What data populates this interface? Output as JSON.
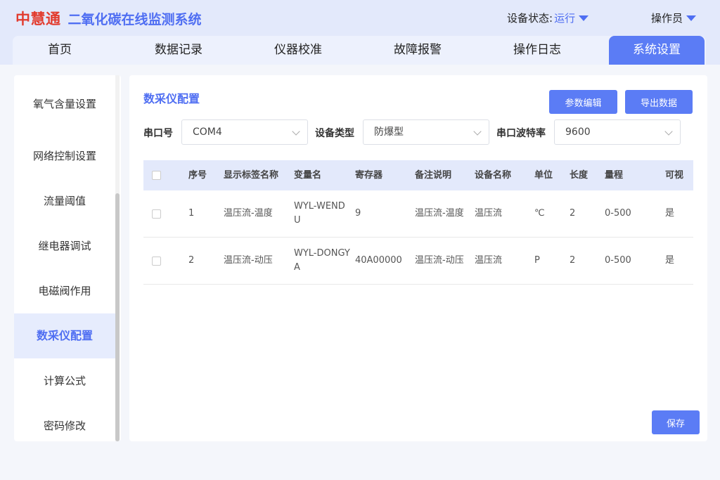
{
  "header": {
    "logo": "中慧通",
    "title": "二氧化碳在线监测系统",
    "status_label": "设备状态:",
    "status_value": "运行",
    "operator": "操作员",
    "accent": "#4f6ef2",
    "brand_red": "#e23b2e"
  },
  "nav": {
    "tabs": [
      {
        "label": "首页"
      },
      {
        "label": "数据记录"
      },
      {
        "label": "仪器校准"
      },
      {
        "label": "故障报警"
      },
      {
        "label": "操作日志"
      },
      {
        "label": "系统设置",
        "active": true
      }
    ]
  },
  "sidebar": {
    "items": [
      {
        "label": "氧气含量设置"
      },
      {
        "label": "网络控制设置"
      },
      {
        "label": "流量阈值"
      },
      {
        "label": "继电器调试"
      },
      {
        "label": "电磁阀作用"
      },
      {
        "label": "数采仪配置",
        "active": true
      },
      {
        "label": "计算公式"
      },
      {
        "label": "密码修改"
      }
    ]
  },
  "main": {
    "title": "数采仪配置",
    "edit_button": "参数编辑",
    "export_button": "导出数据",
    "save_button": "保存",
    "serial_label": "串口号",
    "serial_value": "COM4",
    "device_type_label": "设备类型",
    "device_type_value": "防爆型",
    "baud_label": "串口波特率",
    "baud_value": "9600"
  },
  "table": {
    "columns": [
      "序号",
      "显示标签名称",
      "变量名",
      "寄存器",
      "备注说明",
      "设备名称",
      "单位",
      "长度",
      "量程",
      "可视"
    ],
    "rows": [
      [
        "1",
        "温压流-温度",
        "WYL-WENDU",
        "9",
        "温压流-温度",
        "温压流",
        "℃",
        "2",
        "0-500",
        "是"
      ],
      [
        "2",
        "温压流-动压",
        "WYL-DONGYA",
        "40A00000",
        "温压流-动压",
        "温压流",
        "P",
        "2",
        "0-500",
        "是"
      ]
    ]
  }
}
